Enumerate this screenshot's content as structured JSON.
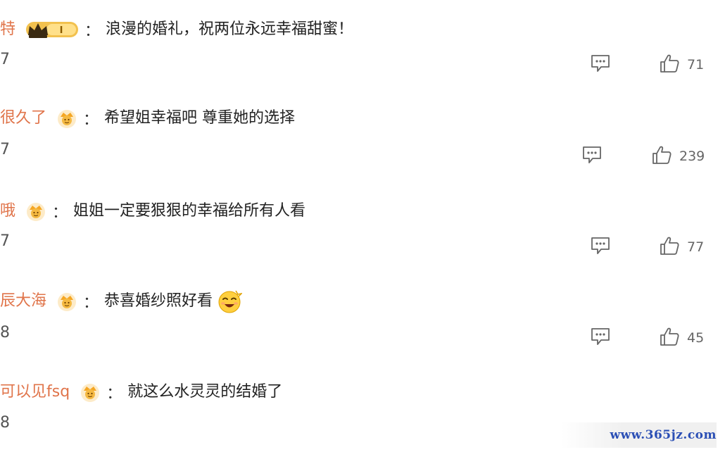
{
  "comments": [
    {
      "username": "特",
      "badge": "crown-level-badge",
      "badge_text": "I",
      "text": "浪漫的婚礼，祝两位永远幸福甜蜜！",
      "meta": "7",
      "likes": "71"
    },
    {
      "username": "很久了",
      "badge": "fan-badge",
      "text": "希望姐幸福吧 尊重她的选择",
      "meta": "7",
      "likes": "239"
    },
    {
      "username": "哦",
      "badge": "fan-badge",
      "text": "姐姐一定要狠狠的幸福给所有人看",
      "meta": "7",
      "likes": "77"
    },
    {
      "username": "辰大海",
      "badge": "fan-badge",
      "text": "恭喜婚纱照好看",
      "emoji": "wink-emoji",
      "meta": "8",
      "likes": "45"
    },
    {
      "username": "可以见fsq",
      "badge": "fan-badge",
      "text": "就这么水灵灵的结婚了",
      "meta": "8"
    }
  ],
  "separator": "：",
  "watermark": "www.365jz.com",
  "colors": {
    "username": "#e0744a",
    "badge_gold": "#f2c14e",
    "text": "#222222",
    "icon": "#666666",
    "watermark": "#2b4fb5"
  }
}
